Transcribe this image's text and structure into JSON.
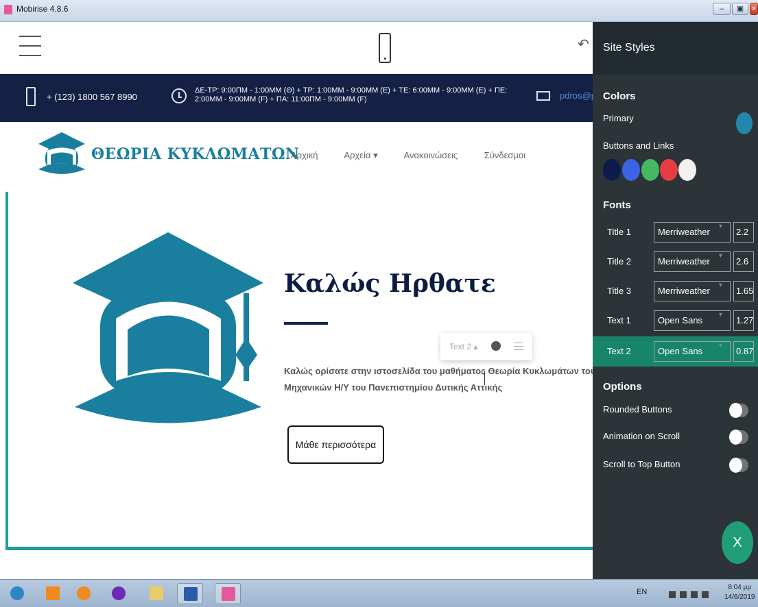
{
  "window": {
    "title": "Mobirise 4.8.6"
  },
  "topbar": {},
  "info": {
    "phone": "+ (123) 1800 567 8990",
    "hours": "ΔΕ-ΤΡ: 9:00ΠΜ - 1:00ΜΜ (Θ) + ΤΡ: 1:00ΜΜ - 9:00ΜΜ (Ε) + ΤΕ: 6:00ΜΜ - 9:00ΜΜ (Ε) + ΠΕ: 2:00ΜΜ - 9:00ΜΜ (F) + ΠΑ: 11:00ΠΜ - 9:00ΜΜ (F)",
    "email": "pdros@p"
  },
  "brand": {
    "name": "ΘΕΩΡΙΑ ΚΥΚΛΩΜΑΤΩΝ"
  },
  "nav": {
    "items": [
      "Αρχική",
      "Αρχεία ▾",
      "Ανακοινώσεις",
      "Σύνδεσμοι"
    ]
  },
  "hero": {
    "title": "Καλώς Ηρθατε",
    "line1": "Καλώς ορίσατε στην ιστοσελίδα του μαθήματος Θεωρία Κυκλωμάτων του τμήμ",
    "line2": "Μηχανικών Η/Υ του Πανεπιστημίου Δυτικής Αττικής",
    "button": "Μάθε περισσότερα"
  },
  "floating_toolbar": {
    "label": "Text 2 ▴"
  },
  "panel": {
    "title": "Site Styles",
    "colors_title": "Colors",
    "primary_label": "Primary",
    "buttons_links_label": "Buttons and Links",
    "primary_color": "#2387ad",
    "button_colors": [
      "#0d1c4a",
      "#3c62e5",
      "#44b862",
      "#e63c43",
      "#f1f1f1"
    ],
    "fonts_title": "Fonts",
    "fonts": [
      {
        "label": "Title 1",
        "family": "Merriweather",
        "size": "2.2"
      },
      {
        "label": "Title 2",
        "family": "Merriweather",
        "size": "2.6"
      },
      {
        "label": "Title 3",
        "family": "Merriweather",
        "size": "1.65"
      },
      {
        "label": "Text 1",
        "family": "Open Sans",
        "size": "1.27"
      },
      {
        "label": "Text 2",
        "family": "Open Sans",
        "size": "0.87"
      }
    ],
    "options_title": "Options",
    "options": [
      "Rounded Buttons",
      "Animation on Scroll",
      "Scroll to Top Button"
    ],
    "close_label": "X"
  },
  "taskbar": {
    "lang": "EN",
    "time": "8:04 μμ",
    "date": "14/6/2019"
  }
}
